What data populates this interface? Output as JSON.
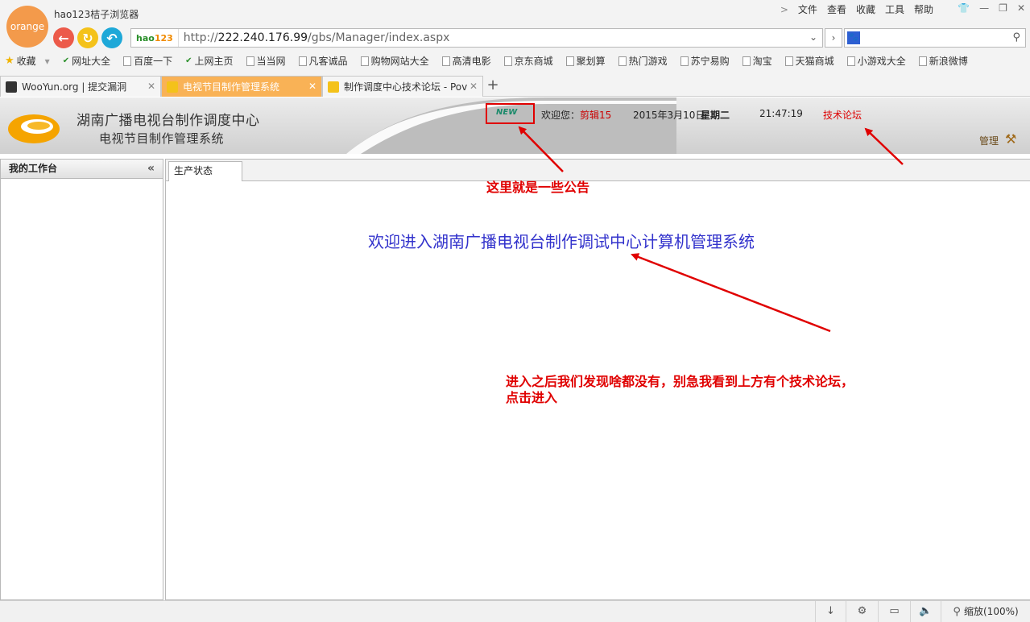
{
  "browser": {
    "logo_text": "orange",
    "title": "hao123桔子浏览器",
    "menu": [
      "文件",
      "查看",
      "收藏",
      "工具",
      "帮助"
    ],
    "address": {
      "badge_hao": "hao",
      "badge_num": "123",
      "url_prefix": "http://",
      "url_host": "222.240.176.99",
      "url_path": "/gbs/Manager/index.aspx"
    },
    "bookmarks": [
      "收藏",
      "网址大全",
      "百度一下",
      "上网主页",
      "当当网",
      "凡客诚品",
      "购物网站大全",
      "高清电影",
      "京东商城",
      "聚划算",
      "热门游戏",
      "苏宁易购",
      "淘宝",
      "天猫商城",
      "小游戏大全",
      "新浪微博"
    ],
    "tabs": [
      {
        "label": "WooYun.org | 提交漏洞",
        "active": false
      },
      {
        "label": "电视节目制作管理系统",
        "active": true
      },
      {
        "label": "制作调度中心技术论坛 - Pov",
        "active": false
      }
    ],
    "new_tab": "+",
    "zoom": "缩放(100%)"
  },
  "app": {
    "title_line1": "湖南广播电视台制作调度中心",
    "title_line2": "电视节目制作管理系统",
    "new_badge": "NEW",
    "welcome_prefix": "欢迎您：",
    "user": "剪辑15",
    "date": "2015年3月10日",
    "weekday": "星期二",
    "time": "21:47:19",
    "forum_link": "技术论坛",
    "manage_label": "管理",
    "sidebar_title": "我的工作台",
    "content_tab": "生产状态",
    "welcome_message": "欢迎进入湖南广播电视台制作调试中心计算机管理系统"
  },
  "annotations": {
    "notice": "这里就是一些公告",
    "line1": "进入之后我们发现啥都没有，别急我看到上方有个技术论坛，",
    "line2": "点击进入"
  },
  "colors": {
    "annotation_red": "#e00000",
    "active_tab": "#f9b256",
    "welcome_blue": "#3333cc"
  }
}
